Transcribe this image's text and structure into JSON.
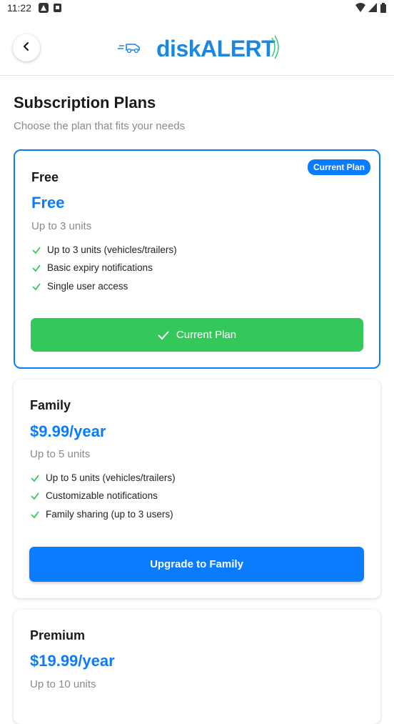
{
  "status_bar": {
    "time": "11:22"
  },
  "header": {
    "logo_part1": "disk",
    "logo_part2": "ALERT"
  },
  "page": {
    "title": "Subscription Plans",
    "subtitle": "Choose the plan that fits your needs"
  },
  "plans": [
    {
      "name": "Free",
      "price": "Free",
      "units": "Up to 3 units",
      "badge": "Current Plan",
      "features": [
        "Up to 3 units (vehicles/trailers)",
        "Basic expiry notifications",
        "Single user access"
      ],
      "button": "Current Plan"
    },
    {
      "name": "Family",
      "price": "$9.99/year",
      "units": "Up to 5 units",
      "features": [
        "Up to 5 units (vehicles/trailers)",
        "Customizable notifications",
        "Family sharing (up to 3 users)"
      ],
      "button": "Upgrade to Family"
    },
    {
      "name": "Premium",
      "price": "$19.99/year",
      "units": "Up to 10 units"
    }
  ],
  "colors": {
    "accent": "#0a7cff",
    "success": "#34c85a"
  }
}
